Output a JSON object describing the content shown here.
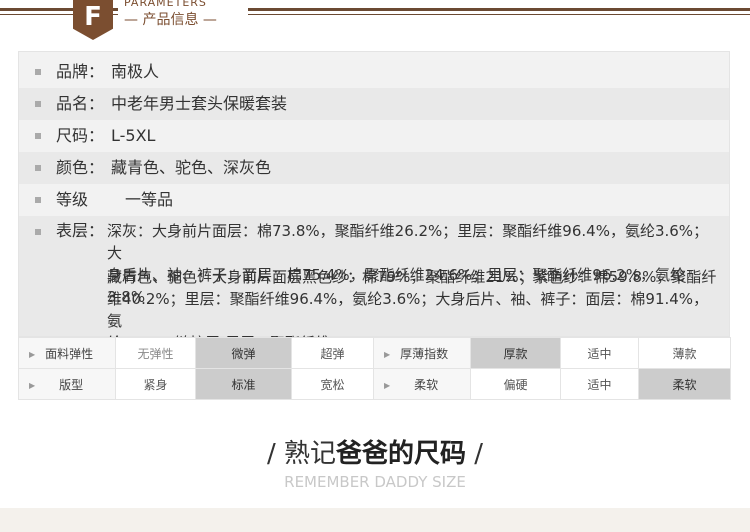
{
  "header": {
    "badge": "F",
    "english": "PARAMETERS",
    "chinese": "— 产品信息 —"
  },
  "info": {
    "rows": [
      {
        "label": "品牌：",
        "value": "南极人"
      },
      {
        "label": "品名：",
        "value": "中老年男士套头保暖套装"
      },
      {
        "label": "尺码：",
        "value": "L-5XL"
      },
      {
        "label": "颜色：",
        "value": "藏青色、驼色、深灰色"
      },
      {
        "label": "等级",
        "value": "一等品"
      }
    ],
    "fabric": {
      "label": "表层：",
      "line1": "深灰：大身前片面层：棉73.8%，聚酯纤维26.2%；里层：聚酯纤维96.4%，氨纶3.6%；大",
      "line2": "身后片、袖、裤子：面层：棉75.4%，聚酯纤维24.6%；里层：聚酯纤维96.2%，氨纶3.8%",
      "line3": "藏青色、驼色：大身前片面层黑色纱：棉79%，聚酯纤维21%；紫色纱：棉59.8%，聚酯纤",
      "line4": "维40.2%；里层：聚酯纤维96.4%，氨纶3.6%；大身后片、袖、裤子：面层：棉91.4%，氨",
      "line5": "纶8.6%；链接层/里层：聚酯纤维100%"
    }
  },
  "attributes": {
    "rows": [
      {
        "label": "面料弹性",
        "options": [
          "无弹性",
          "微弹",
          "超弹"
        ],
        "selected": 1,
        "label2": "厚薄指数",
        "options2": [
          "厚款",
          "适中",
          "薄款"
        ],
        "selected2": 0
      },
      {
        "label": "版型",
        "options": [
          "紧身",
          "标准",
          "宽松"
        ],
        "selected": 1,
        "label2": "柔软",
        "options2": [
          "偏硬",
          "适中",
          "柔软"
        ],
        "selected2": 2
      }
    ]
  },
  "footer": {
    "title_prefix": "/ 熟记",
    "title_bold": "爸爸的尺码",
    "title_suffix": " /",
    "subtitle": "REMEMBER DADDY SIZE"
  }
}
